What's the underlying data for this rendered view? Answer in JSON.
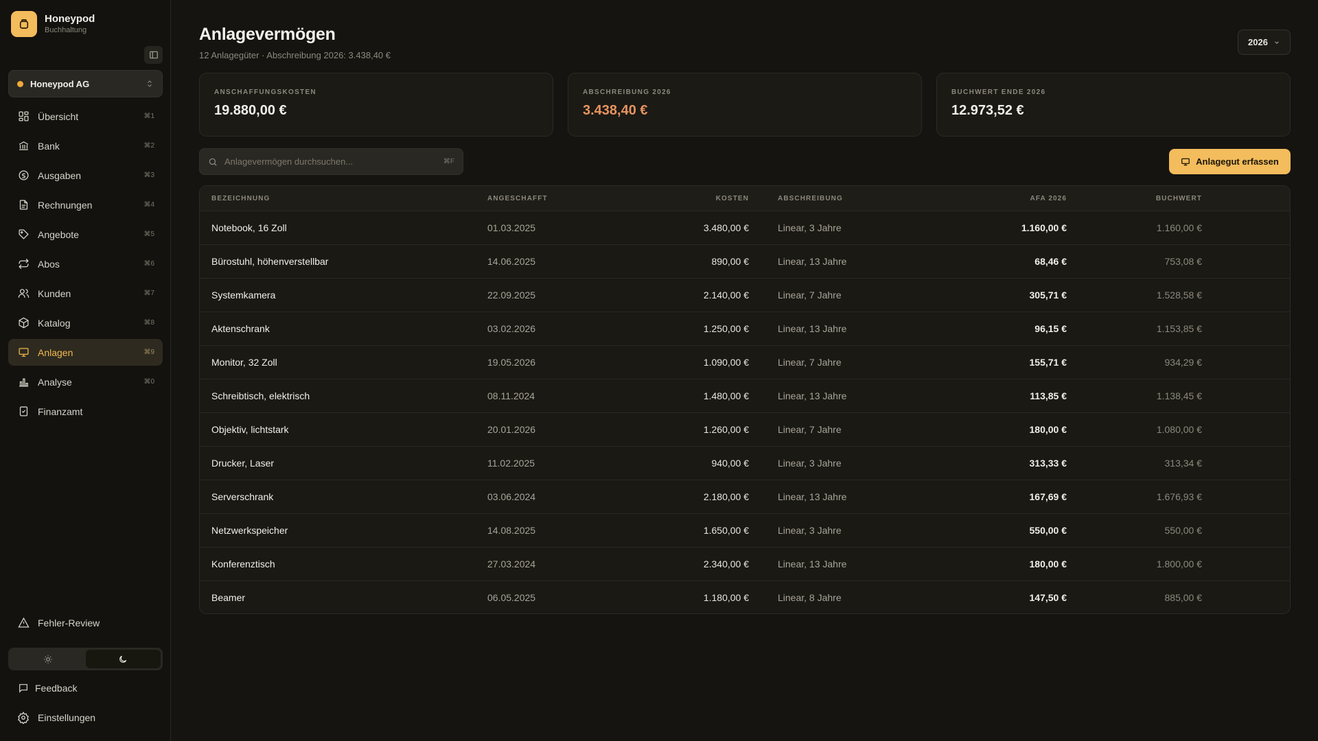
{
  "brand": {
    "name": "Honeypod",
    "subtitle": "Buchhaltung"
  },
  "company": {
    "name": "Honeypod AG"
  },
  "nav": [
    {
      "label": "Übersicht",
      "shortcut": "⌘1",
      "icon": "grid-icon"
    },
    {
      "label": "Bank",
      "shortcut": "⌘2",
      "icon": "bank-icon"
    },
    {
      "label": "Ausgaben",
      "shortcut": "⌘3",
      "icon": "expense-icon"
    },
    {
      "label": "Rechnungen",
      "shortcut": "⌘4",
      "icon": "invoice-icon"
    },
    {
      "label": "Angebote",
      "shortcut": "⌘5",
      "icon": "tag-icon"
    },
    {
      "label": "Abos",
      "shortcut": "⌘6",
      "icon": "repeat-icon"
    },
    {
      "label": "Kunden",
      "shortcut": "⌘7",
      "icon": "users-icon"
    },
    {
      "label": "Katalog",
      "shortcut": "⌘8",
      "icon": "package-icon"
    },
    {
      "label": "Anlagen",
      "shortcut": "⌘9",
      "icon": "monitor-icon",
      "active": true
    },
    {
      "label": "Analyse",
      "shortcut": "⌘0",
      "icon": "chart-icon"
    },
    {
      "label": "Finanzamt",
      "shortcut": "",
      "icon": "tax-icon"
    }
  ],
  "footer": {
    "review": "Fehler-Review",
    "feedback": "Feedback",
    "settings": "Einstellungen"
  },
  "header": {
    "title": "Anlagevermögen",
    "subtitle": "12 Anlagegüter · Abschreibung 2026: 3.438,40 €",
    "year": "2026"
  },
  "cards": [
    {
      "label": "ANSCHAFFUNGSKOSTEN",
      "value": "19.880,00 €"
    },
    {
      "label": "ABSCHREIBUNG 2026",
      "value": "3.438,40 €",
      "accent": "#e8935e"
    },
    {
      "label": "BUCHWERT ENDE 2026",
      "value": "12.973,52 €"
    }
  ],
  "search": {
    "placeholder": "Anlagevermögen durchsuchen...",
    "shortcut": "⌘F"
  },
  "add_button": "Anlagegut erfassen",
  "table": {
    "columns": [
      "BEZEICHNUNG",
      "ANGESCHAFFT",
      "KOSTEN",
      "ABSCHREIBUNG",
      "AFA 2026",
      "BUCHWERT"
    ],
    "rows": [
      [
        "Notebook, 16 Zoll",
        "01.03.2025",
        "3.480,00 €",
        "Linear, 3 Jahre",
        "1.160,00 €",
        "1.160,00 €"
      ],
      [
        "Bürostuhl, höhenverstellbar",
        "14.06.2025",
        "890,00 €",
        "Linear, 13 Jahre",
        "68,46 €",
        "753,08 €"
      ],
      [
        "Systemkamera",
        "22.09.2025",
        "2.140,00 €",
        "Linear, 7 Jahre",
        "305,71 €",
        "1.528,58 €"
      ],
      [
        "Aktenschrank",
        "03.02.2026",
        "1.250,00 €",
        "Linear, 13 Jahre",
        "96,15 €",
        "1.153,85 €"
      ],
      [
        "Monitor, 32 Zoll",
        "19.05.2026",
        "1.090,00 €",
        "Linear, 7 Jahre",
        "155,71 €",
        "934,29 €"
      ],
      [
        "Schreibtisch, elektrisch",
        "08.11.2024",
        "1.480,00 €",
        "Linear, 13 Jahre",
        "113,85 €",
        "1.138,45 €"
      ],
      [
        "Objektiv, lichtstark",
        "20.01.2026",
        "1.260,00 €",
        "Linear, 7 Jahre",
        "180,00 €",
        "1.080,00 €"
      ],
      [
        "Drucker, Laser",
        "11.02.2025",
        "940,00 €",
        "Linear, 3 Jahre",
        "313,33 €",
        "313,34 €"
      ],
      [
        "Serverschrank",
        "03.06.2024",
        "2.180,00 €",
        "Linear, 13 Jahre",
        "167,69 €",
        "1.676,93 €"
      ],
      [
        "Netzwerkspeicher",
        "14.08.2025",
        "1.650,00 €",
        "Linear, 3 Jahre",
        "550,00 €",
        "550,00 €"
      ],
      [
        "Konferenztisch",
        "27.03.2024",
        "2.340,00 €",
        "Linear, 13 Jahre",
        "180,00 €",
        "1.800,00 €"
      ],
      [
        "Beamer",
        "06.05.2025",
        "1.180,00 €",
        "Linear, 8 Jahre",
        "147,50 €",
        "885,00 €"
      ]
    ]
  }
}
